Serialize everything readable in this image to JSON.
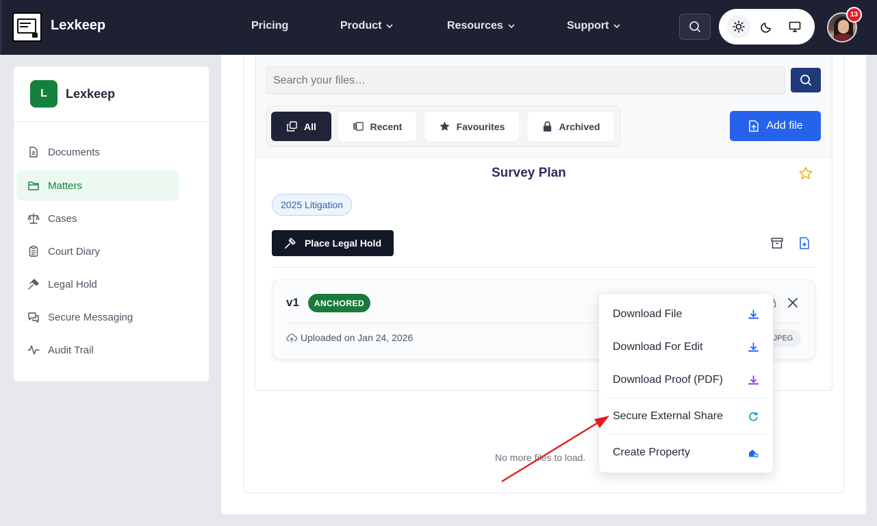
{
  "app": {
    "brand": "Lexkeep"
  },
  "nav": {
    "items": [
      {
        "label": "Pricing",
        "has_dropdown": false
      },
      {
        "label": "Product",
        "has_dropdown": true
      },
      {
        "label": "Resources",
        "has_dropdown": true
      },
      {
        "label": "Support",
        "has_dropdown": true
      }
    ],
    "notification_count": "13"
  },
  "sidebar": {
    "logo_letter": "L",
    "title": "Lexkeep",
    "items": [
      {
        "label": "Documents",
        "icon": "document-icon",
        "active": false
      },
      {
        "label": "Matters",
        "icon": "folder-icon",
        "active": true
      },
      {
        "label": "Cases",
        "icon": "scales-icon",
        "active": false
      },
      {
        "label": "Court Diary",
        "icon": "clipboard-icon",
        "active": false
      },
      {
        "label": "Legal Hold",
        "icon": "gavel-icon",
        "active": false
      },
      {
        "label": "Secure Messaging",
        "icon": "chat-icon",
        "active": false
      },
      {
        "label": "Audit Trail",
        "icon": "activity-icon",
        "active": false
      }
    ]
  },
  "files": {
    "search_placeholder": "Search your files…",
    "tabs": [
      {
        "label": "All",
        "active": true
      },
      {
        "label": "Recent",
        "active": false
      },
      {
        "label": "Favourites",
        "active": false
      },
      {
        "label": "Archived",
        "active": false
      }
    ],
    "add_file_label": "Add file",
    "empty_message": "No more files to load."
  },
  "document": {
    "title": "Survey Plan",
    "tag": "2025 Litigation",
    "legal_hold_label": "Place Legal Hold",
    "version": {
      "label": "v1",
      "status": "ANCHORED",
      "uploaded": "Uploaded on Jan 24, 2026",
      "type": "JPEG"
    }
  },
  "menu": {
    "items": [
      {
        "label": "Download File",
        "icon": "download-icon",
        "color": "#2563eb"
      },
      {
        "label": "Download For Edit",
        "icon": "download-icon",
        "color": "#2563eb"
      },
      {
        "label": "Download Proof (PDF)",
        "icon": "download-icon",
        "color": "#9333ea"
      },
      {
        "label": "Secure External Share",
        "icon": "share-icon",
        "color": "#0891b2"
      },
      {
        "label": "Create Property",
        "icon": "property-icon",
        "color": "#2563eb"
      }
    ]
  },
  "colors": {
    "topbar": "#1e2132",
    "accent_green": "#15803d",
    "primary_blue": "#2563eb",
    "annotation_arrow": "#e11d1d"
  }
}
